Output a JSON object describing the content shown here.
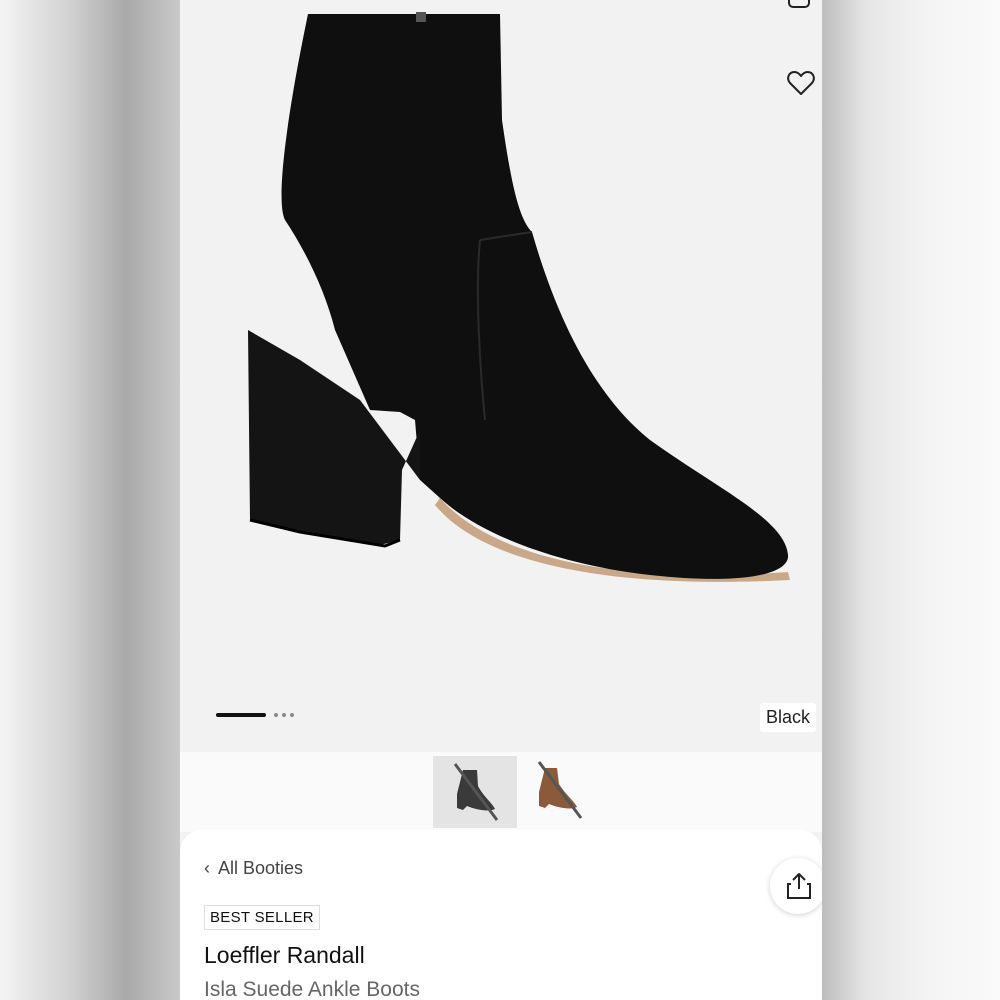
{
  "gallery": {
    "selected_color": "Black",
    "slide_count": 4,
    "active_slide": 1,
    "thumbnails": [
      {
        "name": "black",
        "color": "#2a2a2a",
        "selected": true
      },
      {
        "name": "brown",
        "color": "#8a5a3b",
        "selected": false
      }
    ]
  },
  "icons": {
    "favorite": "heart-icon",
    "share": "share-icon",
    "back": "chevron-left-icon"
  },
  "details": {
    "breadcrumb": "All Booties",
    "badge": "BEST SELLER",
    "brand": "Loeffler Randall",
    "product_name": "Isla Suede Ankle Boots"
  }
}
